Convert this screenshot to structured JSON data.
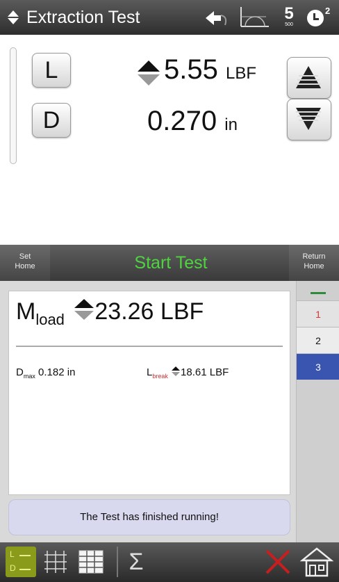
{
  "titlebar": {
    "title": "Extraction Test",
    "icons": [
      "sort-caret-icon",
      "undo-icon",
      "graph-origin-icon",
      "sample-rate-icon",
      "clock-icon"
    ],
    "sample_digit": "5",
    "sample_sub": "500",
    "clock_sup": "2"
  },
  "readout": {
    "load": {
      "key": "L",
      "value": "5.55",
      "unit": "LBF"
    },
    "distance": {
      "key": "D",
      "value": "0.270",
      "unit": "in"
    },
    "jog_icons": [
      "jog-up-icon",
      "jog-down-icon"
    ]
  },
  "actionbar": {
    "set_home_l1": "Set",
    "set_home_l2": "Home",
    "start": "Start Test",
    "return_home_l1": "Return",
    "return_home_l2": "Home"
  },
  "results": {
    "mload": {
      "symbol": "M",
      "subscript": "load",
      "value": "23.26",
      "unit": "LBF"
    },
    "dmax": {
      "symbol": "D",
      "subscript": "max",
      "value": "0.182",
      "unit": "in"
    },
    "lbreak": {
      "symbol": "L",
      "subscript": "break",
      "value": "18.61",
      "unit": "LBF"
    },
    "status": "The Test has finished running!"
  },
  "tabs": [
    "1",
    "2",
    "3"
  ],
  "bottombar": {
    "icons": [
      "load-distance-view-icon",
      "grid-view-icon",
      "table-view-icon",
      "sigma-icon",
      "cancel-x-icon",
      "home-icon"
    ],
    "ld_top": "L",
    "ld_bottom": "D",
    "sigma": "Σ"
  },
  "colors": {
    "start_green": "#4fd43f",
    "selected_tab": "#3a55b0",
    "tab1_red": "#dd3333",
    "status_bg": "#d8d8ee",
    "cancel_red": "#c81e1e"
  }
}
